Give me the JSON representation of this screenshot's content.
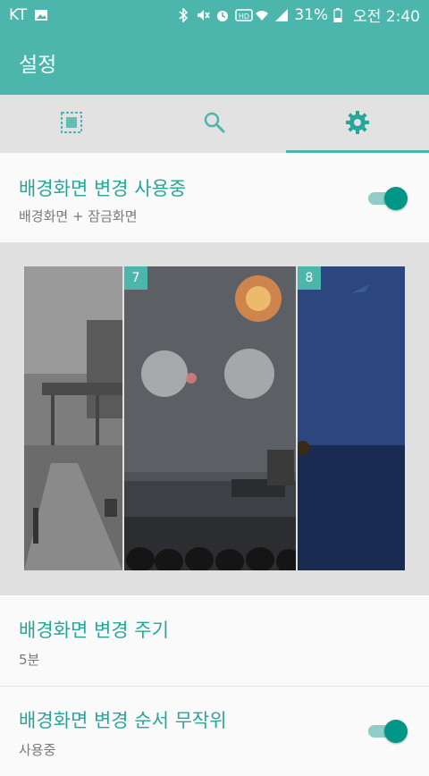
{
  "status_bar": {
    "carrier": "KT",
    "battery": "31%",
    "time": "오전 2:40",
    "icons": [
      "image-icon",
      "bluetooth-icon",
      "mute-icon",
      "alarm-icon",
      "hd-icon",
      "wifi-icon",
      "signal-icon",
      "battery-icon"
    ]
  },
  "app_bar": {
    "title": "설정"
  },
  "tabs": [
    {
      "icon": "wallpaper-frame-icon",
      "active": false
    },
    {
      "icon": "search-icon",
      "active": false
    },
    {
      "icon": "gear-icon",
      "active": true
    }
  ],
  "settings": {
    "enable": {
      "title": "배경화면 변경 사용중",
      "subtitle": "배경화면 + 잠금화면",
      "on": true
    },
    "interval": {
      "title": "배경화면 변경 주기",
      "subtitle": "5분"
    },
    "random": {
      "title": "배경화면 변경 순서 무작위",
      "subtitle": "사용중",
      "on": true
    }
  },
  "gallery": {
    "items": [
      {
        "number": ""
      },
      {
        "number": "7"
      },
      {
        "number": "8"
      }
    ]
  },
  "colors": {
    "accent": "#4db6ac",
    "accent_dark": "#009688",
    "title_text": "#26a69a"
  }
}
